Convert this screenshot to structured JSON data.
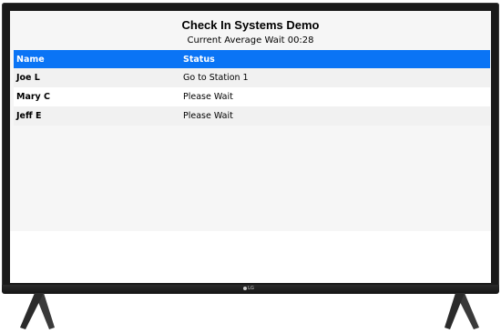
{
  "app": {
    "title": "Check In Systems Demo",
    "subtitle": "Current Average Wait 00:28"
  },
  "table": {
    "columns": [
      "Name",
      "Status"
    ],
    "rows": [
      {
        "name": "Joe L",
        "status": "Go to Station 1"
      },
      {
        "name": "Mary C",
        "status": "Please Wait"
      },
      {
        "name": "Jeff E",
        "status": "Please Wait"
      }
    ]
  },
  "device": {
    "logo_text": "LG"
  },
  "colors": {
    "header_bg": "#0a74f5",
    "header_text": "#ffffff",
    "row_alt": "#f1f1f1",
    "tv_frame": "#1a1a1a"
  }
}
